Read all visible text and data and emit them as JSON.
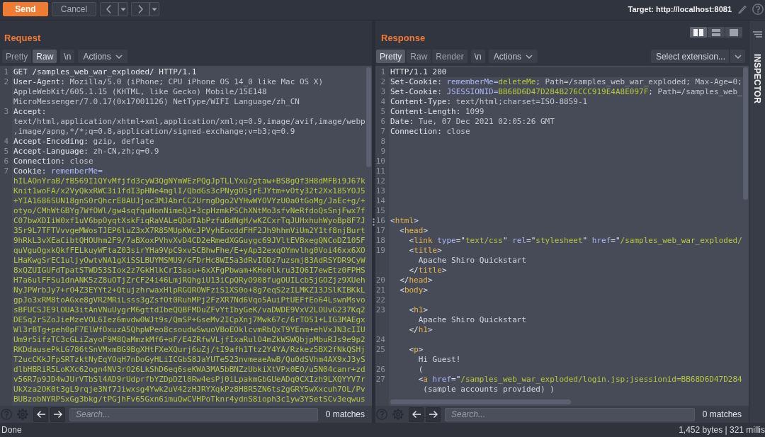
{
  "toolbar": {
    "send": "Send",
    "cancel": "Cancel",
    "target": "Target: http://localhost:8081"
  },
  "request": {
    "title": "Request",
    "view_tabs": [
      {
        "label": "Pretty",
        "selected": false
      },
      {
        "label": "Raw",
        "selected": true
      }
    ],
    "newline_toggle": {
      "label": "\\n",
      "on": false
    },
    "actions": "Actions",
    "lines": [
      {
        "number": "1",
        "wraps": [
          {
            "spans": [
              {
                "kind": "plain",
                "text": "GET /samples_web_war_exploded/ HTTP/1.1"
              }
            ]
          }
        ]
      },
      {
        "number": "2",
        "wraps": [
          {
            "spans": [
              {
                "kind": "key",
                "text": "User-Agent:"
              },
              {
                "kind": "value",
                "text": " Mozilla/5.0 (iPhone; CPU iPhone OS 14_0 like Mac OS X)"
              }
            ]
          },
          {
            "spans": [
              {
                "kind": "value",
                "text": "AppleWebKit/605.1.15 (KHTML, like Gecko) Mobile/15E148"
              }
            ]
          },
          {
            "spans": [
              {
                "kind": "value",
                "text": "MicroMessenger/7.0.17(0x17001126) NetType/WIFI Language/zh_CN"
              }
            ]
          }
        ]
      },
      {
        "number": "3",
        "wraps": [
          {
            "spans": [
              {
                "kind": "key",
                "text": "Accept:"
              }
            ]
          },
          {
            "spans": [
              {
                "kind": "value",
                "text": "text/html,application/xhtml+xml,application/xml;q=0.9,image/avif,image/webp"
              }
            ]
          },
          {
            "spans": [
              {
                "kind": "value",
                "text": ",image/apng,*/*;q=0.8,application/signed-exchange;v=b3;q=0.9"
              }
            ]
          }
        ]
      },
      {
        "number": "4",
        "wraps": [
          {
            "spans": [
              {
                "kind": "key",
                "text": "Accept-Encoding:"
              },
              {
                "kind": "value",
                "text": " gzip, deflate"
              }
            ]
          }
        ]
      },
      {
        "number": "5",
        "wraps": [
          {
            "spans": [
              {
                "kind": "key",
                "text": "Accept-Language:"
              },
              {
                "kind": "value",
                "text": " zh-CN,zh;q=0.9"
              }
            ]
          }
        ]
      },
      {
        "number": "6",
        "wraps": [
          {
            "spans": [
              {
                "kind": "key",
                "text": "Connection:"
              },
              {
                "kind": "value",
                "text": " close"
              }
            ]
          }
        ]
      },
      {
        "number": "7",
        "wraps": [
          {
            "spans": [
              {
                "kind": "key",
                "text": "Cookie:"
              },
              {
                "kind": "param",
                "text": " rememberMe="
              }
            ]
          },
          {
            "spans": [
              {
                "kind": "data",
                "text": "hILAOnYraB/fB569I1QYvMfjfd3cyW3QgNYmWEzPQgJpTLLYxu7gtaw+BS8gQf3H8dMFBi9J67k"
              }
            ]
          },
          {
            "spans": [
              {
                "kind": "data",
                "text": "Knit1woFA/x2VyQkxRWC3i1fdI3pHNe4mglI/QbdGs3cPNygOSjrEJYtm+vOty32t2Xx185YOJ5"
              }
            ]
          },
          {
            "spans": [
              {
                "kind": "data",
                "text": "+YIA1686SUN18gnS0rQhcrE8AUJjoc3MJAbrCC2UrngDgo2VYHwWYOVYzU0a0tGoMg/JaEc+g/+"
              }
            ]
          },
          {
            "spans": [
              {
                "kind": "data",
                "text": "otyo/CMhWtGBYg7WfOWl/gw4sqfquHonNimeQJ+3cpHzmkPSChXNtMo3sfvNeRfdoQsSnjFwx7f"
              }
            ]
          },
          {
            "spans": [
              {
                "kind": "data",
                "text": "C07bwXDIiW0xf1uV6bpOyqtXskFiqRaVALeQDdTAbPzfuBdNgH/wKZCxrTqJUHxhuhWyoBp8F7J"
              }
            ]
          },
          {
            "spans": [
              {
                "kind": "data",
                "text": "35r9L7TFTVvvgeMWosTJEP6luZ3xX7R85MUpKWcJPVyhEocddFHF2Jh9hhmViUm2Y1tf8njBurt"
              }
            ]
          },
          {
            "spans": [
              {
                "kind": "data",
                "text": "9hRkL3vXEaCibtQHOUhm2F9/7aBXoxPVhvXvD4CD2eRmedXGGuygc69JVltEVBxegQNCoDZ105F"
              }
            ]
          },
          {
            "spans": [
              {
                "kind": "data",
                "text": "quVguOgxkQkfFELkuyWFtaZ03sirYHa9VpC9xv5CBhwFhe/E+yAp32exqOYmvlhg0Voi46xx6XO"
              }
            ]
          },
          {
            "spans": [
              {
                "kind": "data",
                "text": "LHaKwgSrEC1uljyOwtvNA1gXiSSLBUYMSMU9/GFDrHc8WI5a3dRvIODz7uzsmj83AdRSYDR9CyW"
              }
            ]
          },
          {
            "spans": [
              {
                "kind": "data",
                "text": "8xQZUIGUFdTpatSTWD53SIox2z7GkHlkCrI3asu+6xXFgPbwam+KHo0lkru3IQ6I7ewEtz0FPHS"
              }
            ]
          },
          {
            "spans": [
              {
                "kind": "data",
                "text": "H7a6ulFFSu1dnANK5zZ8uOTjZrCF24i46LmjRQhgiU13iCpQRyO908fugOUILcb5jGOZjz9XUeh"
              }
            ]
          },
          {
            "spans": [
              {
                "kind": "data",
                "text": "NyJPWrbJy7+rO4Z3EYYt2+QtujzhrwaxHlpRGQROWFziS1XS0o+8g7eqS2zILMKZ13JSlKIBKkL"
              }
            ]
          },
          {
            "spans": [
              {
                "kind": "data",
                "text": "gpJo3xRM8toAGxe8gVR2MRiLsss3gZsfOt0RuhMPj2FzXR7Nd6Vqo5AuiPtUEFfEo64LswnMsvo"
              }
            ]
          },
          {
            "spans": [
              {
                "kind": "data",
                "text": "sBFUCSJE9lOUA3itAnVNuUygrM6gttdIbeQQBFMDuZFvYtIbyGeK/vaDWDE9VxV2LOUvG237Kq2"
              }
            ]
          },
          {
            "spans": [
              {
                "kind": "data",
                "text": "DE5q2rSZoJieMzeVOL6Iez6mvdw0WJt9s/QmSP+GseMv2ICpXnj7Mwk67c/6rTO51+LIG3MAEgx"
              }
            ]
          },
          {
            "spans": [
              {
                "kind": "data",
                "text": "Wl3rBTg+peh0pF7ElWfOxuzA5QhpWPeo8csoudwSwuoVBoEOklcvmRbQxT9YEnm+ehVxJN3cIIU"
              }
            ]
          },
          {
            "spans": [
              {
                "kind": "data",
                "text": "Um9r5ifzTC3cGLiZayoF9M8QaMmzkMf6+oF/E4ZRfwVLjfIxaRulO4mZkWSWQbjpMbuRJs9e9p2"
              }
            ]
          },
          {
            "spans": [
              {
                "kind": "data",
                "text": "RKDdausePkLG786tSnVMxmBG9BgXHtFXeXQurj6uZj/tI9afh1Ttz2Y4YA/Rzkez5BX2fNkQSHj"
              }
            ]
          },
          {
            "spans": [
              {
                "kind": "data",
                "text": "T2ucCKkJFpSRTzktNyEqYOqH7nDoGyHLiICGbS8JaYUTe523nvmeaeAwB/Qu0dSVhm4AX9xJ3yS"
              }
            ]
          },
          {
            "spans": [
              {
                "kind": "data",
                "text": "dlbHBRiR5LoKXc62ogn4NV3rO26LkShD6eq6seKWA3MA5bBNZzUbkiXtVPx0EO/u5N04canr+zd"
              }
            ]
          },
          {
            "spans": [
              {
                "kind": "data",
                "text": "v56R7p9JD4wJUrVTbSl4AD9rUdprfbYZDpDZl0Rw4esPj0iLpakmGbGUeADq0CXIzh9LXQYYV7r"
              }
            ]
          },
          {
            "spans": [
              {
                "kind": "data",
                "text": "UkXza2OK0t3gL9rqje3Nf7Jiwxsg4Ywk2uV42zHJRYXqkPz8H8R5ZN6ts2gGRY5wXxcuh7OL/Pv"
              }
            ]
          },
          {
            "spans": [
              {
                "kind": "data",
                "text": "BUBzobNYRPSxGg3bkg/tPGjhFv65Gxn6imuQwCVHPoTknr4ydnS8ioph3c1yw3Y5etSCv3eqwus"
              }
            ]
          }
        ]
      }
    ],
    "search": {
      "placeholder": "Search...",
      "matches": "0 matches"
    }
  },
  "response": {
    "title": "Response",
    "layout_buttons": [
      {
        "kind": "side_by_side",
        "selected": true
      },
      {
        "kind": "stacked",
        "selected": false
      },
      {
        "kind": "single",
        "selected": false
      }
    ],
    "view_tabs": [
      {
        "label": "Pretty",
        "selected": true
      },
      {
        "label": "Raw",
        "selected": false
      },
      {
        "label": "Render",
        "selected": false
      }
    ],
    "newline_toggle": {
      "label": "\\n",
      "on": false
    },
    "actions": "Actions",
    "extension_select": "Select extension...",
    "lines": [
      {
        "number": "1",
        "highlighted": true,
        "wraps": [
          {
            "spans": [
              {
                "kind": "plain",
                "text": "HTTP/1.1 200"
              }
            ]
          }
        ]
      },
      {
        "number": "2",
        "highlighted": false,
        "wraps": [
          {
            "spans": [
              {
                "kind": "key",
                "text": "Set-Cookie:"
              },
              {
                "kind": "param",
                "text": " rememberMe="
              },
              {
                "kind": "data",
                "text": "deleteMe"
              },
              {
                "kind": "value",
                "text": "; Path=/samples_web_war_exploded; Max-Age=0;"
              }
            ]
          }
        ]
      },
      {
        "number": "3",
        "highlighted": false,
        "wraps": [
          {
            "spans": [
              {
                "kind": "key",
                "text": "Set-Cookie:"
              },
              {
                "kind": "param",
                "text": " JSESSIONID="
              },
              {
                "kind": "data",
                "text": "BB68D6D47D284B276CCC919E4A8E097F"
              },
              {
                "kind": "value",
                "text": "; Path=/samples_web_"
              }
            ]
          }
        ]
      },
      {
        "number": "4",
        "highlighted": false,
        "wraps": [
          {
            "spans": [
              {
                "kind": "key",
                "text": "Content-Type:"
              },
              {
                "kind": "value",
                "text": " text/html;charset=ISO-8859-1"
              }
            ]
          }
        ]
      },
      {
        "number": "5",
        "highlighted": false,
        "wraps": [
          {
            "spans": [
              {
                "kind": "key",
                "text": "Content-Length:"
              },
              {
                "kind": "value",
                "text": " 1099"
              }
            ]
          }
        ]
      },
      {
        "number": "6",
        "highlighted": false,
        "wraps": [
          {
            "spans": [
              {
                "kind": "key",
                "text": "Date:"
              },
              {
                "kind": "value",
                "text": " Tue, 07 Dec 2021 02:05:26 GMT"
              }
            ]
          }
        ]
      },
      {
        "number": "7",
        "highlighted": false,
        "wraps": [
          {
            "spans": [
              {
                "kind": "key",
                "text": "Connection:"
              },
              {
                "kind": "value",
                "text": " close"
              }
            ]
          }
        ]
      },
      {
        "number": "8",
        "highlighted": false
      },
      {
        "number": "9",
        "highlighted": false
      },
      {
        "number": "10",
        "highlighted": false
      },
      {
        "number": "11",
        "highlighted": false
      },
      {
        "number": "12",
        "highlighted": false
      },
      {
        "number": "13",
        "highlighted": false
      },
      {
        "number": "14",
        "highlighted": false
      },
      {
        "number": "15",
        "highlighted": false
      },
      {
        "number": "16",
        "highlighted": false,
        "wraps": [
          {
            "spans": [
              {
                "kind": "punct",
                "text": "<"
              },
              {
                "kind": "tag",
                "text": "html"
              },
              {
                "kind": "punct",
                "text": ">"
              }
            ]
          }
        ]
      },
      {
        "number": "17",
        "highlighted": false,
        "wraps": [
          {
            "spans": [
              {
                "kind": "punct",
                "text": "  <"
              },
              {
                "kind": "tag",
                "text": "head"
              },
              {
                "kind": "punct",
                "text": ">"
              }
            ]
          }
        ]
      },
      {
        "number": "18",
        "highlighted": false,
        "wraps": [
          {
            "spans": [
              {
                "kind": "punct",
                "text": "    <"
              },
              {
                "kind": "tag",
                "text": "link"
              },
              {
                "kind": "param",
                "text": " type"
              },
              {
                "kind": "punct",
                "text": "=\""
              },
              {
                "kind": "data",
                "text": "text/css"
              },
              {
                "kind": "punct",
                "text": "\" "
              },
              {
                "kind": "param",
                "text": "rel"
              },
              {
                "kind": "punct",
                "text": "=\""
              },
              {
                "kind": "data",
                "text": "stylesheet"
              },
              {
                "kind": "punct",
                "text": "\" "
              },
              {
                "kind": "param",
                "text": "href"
              },
              {
                "kind": "punct",
                "text": "=\""
              },
              {
                "kind": "data",
                "text": "/samples_web_war_exploded/"
              }
            ]
          }
        ]
      },
      {
        "number": "19",
        "highlighted": false,
        "wraps": [
          {
            "spans": [
              {
                "kind": "punct",
                "text": "    <"
              },
              {
                "kind": "tag",
                "text": "title"
              },
              {
                "kind": "punct",
                "text": ">"
              }
            ]
          },
          {
            "spans": [
              {
                "kind": "text",
                "text": "      Apache Shiro Quickstart"
              }
            ]
          },
          {
            "spans": [
              {
                "kind": "punct",
                "text": "    </"
              },
              {
                "kind": "tag",
                "text": "title"
              },
              {
                "kind": "punct",
                "text": ">"
              }
            ]
          }
        ]
      },
      {
        "number": "20",
        "highlighted": false,
        "wraps": [
          {
            "spans": [
              {
                "kind": "punct",
                "text": "  </"
              },
              {
                "kind": "tag",
                "text": "head"
              },
              {
                "kind": "punct",
                "text": ">"
              }
            ]
          }
        ]
      },
      {
        "number": "21",
        "highlighted": false,
        "wraps": [
          {
            "spans": [
              {
                "kind": "punct",
                "text": "  <"
              },
              {
                "kind": "tag",
                "text": "body"
              },
              {
                "kind": "punct",
                "text": ">"
              }
            ]
          }
        ]
      },
      {
        "number": "22",
        "highlighted": false
      },
      {
        "number": "23",
        "highlighted": false,
        "wraps": [
          {
            "spans": [
              {
                "kind": "punct",
                "text": "    <"
              },
              {
                "kind": "tag",
                "text": "h1"
              },
              {
                "kind": "punct",
                "text": ">"
              }
            ]
          },
          {
            "spans": [
              {
                "kind": "text",
                "text": "      Apache Shiro Quickstart"
              }
            ]
          },
          {
            "spans": [
              {
                "kind": "punct",
                "text": "    </"
              },
              {
                "kind": "tag",
                "text": "h1"
              },
              {
                "kind": "punct",
                "text": ">"
              }
            ]
          }
        ]
      },
      {
        "number": "24",
        "highlighted": false
      },
      {
        "number": "25",
        "highlighted": false,
        "wraps": [
          {
            "spans": [
              {
                "kind": "punct",
                "text": "    <"
              },
              {
                "kind": "tag",
                "text": "p"
              },
              {
                "kind": "punct",
                "text": ">"
              }
            ]
          },
          {
            "spans": [
              {
                "kind": "text",
                "text": "      Hi Guest!"
              }
            ]
          }
        ]
      },
      {
        "number": "26",
        "highlighted": false,
        "wraps": [
          {
            "spans": [
              {
                "kind": "text",
                "text": "      ("
              }
            ]
          }
        ]
      },
      {
        "number": "27",
        "highlighted": false,
        "wraps": [
          {
            "spans": [
              {
                "kind": "punct",
                "text": "      <"
              },
              {
                "kind": "tag",
                "text": "a"
              },
              {
                "kind": "param",
                "text": " href"
              },
              {
                "kind": "punct",
                "text": "=\""
              },
              {
                "kind": "data",
                "text": "/samples_web_war_exploded/login.jsp;jsessionid=BB68D6D47D284"
              }
            ]
          },
          {
            "spans": [
              {
                "kind": "text",
                "text": "       (sample accounts provided) )"
              }
            ]
          }
        ]
      }
    ],
    "search": {
      "placeholder": "Search...",
      "matches": "0 matches"
    }
  },
  "inspector": {
    "label": "INSPECTOR"
  },
  "status_bar": {
    "message": "Done",
    "stats": "1,452 bytes | 321 millis"
  }
}
